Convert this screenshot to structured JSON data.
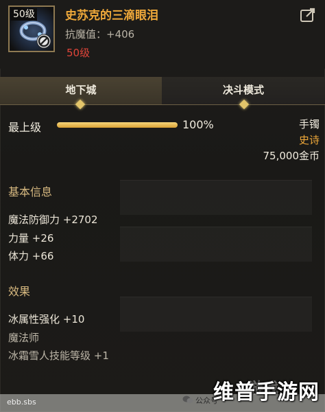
{
  "item": {
    "level_tag": "50级",
    "name": "史苏克的三滴眼泪",
    "resistance": "抗魔值：+406",
    "required_level": "50级"
  },
  "tabs": [
    {
      "label": "地下城",
      "active": true
    },
    {
      "label": "决斗模式",
      "active": false
    }
  ],
  "level_bar": {
    "label": "最上级",
    "percent_text": "100%",
    "fill_fraction": 1.0
  },
  "meta": {
    "slot": "手镯",
    "rarity": "史诗",
    "price": "75,000金币"
  },
  "basic_info": {
    "title": "基本信息",
    "stats": [
      "魔法防御力 +2702",
      "力量 +26",
      "体力 +66"
    ]
  },
  "effects": {
    "title": "效果",
    "lines": [
      "冰属性强化 +10",
      "魔法师",
      "冰霜雪人技能等级 +1"
    ]
  },
  "watermark": {
    "small_left": "ebb.sbs",
    "account": "公众号",
    "faint_overlay": "游戏",
    "brand": "维普手游网"
  },
  "colors": {
    "epic_orange": "#f0a93a",
    "required_red": "#e0453a",
    "gem_gold": "#e3c56a"
  },
  "icons": {
    "ban": "prohibited-icon",
    "share": "share-icon",
    "wechat": "wechat-icon"
  }
}
